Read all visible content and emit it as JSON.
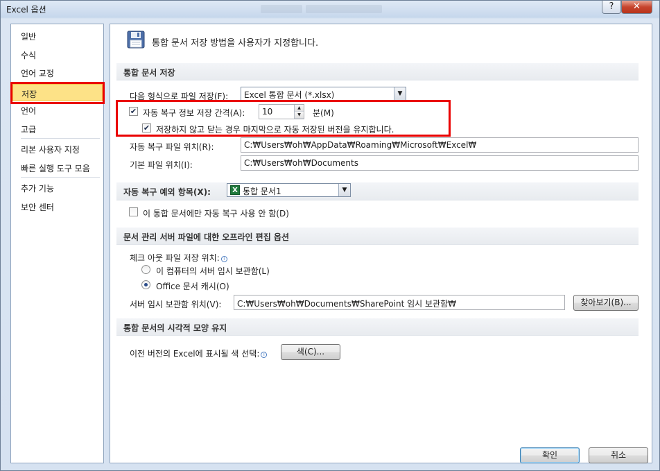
{
  "window": {
    "title": "Excel 옵션",
    "help_label": "?",
    "close_label": "✕"
  },
  "sidebar": {
    "items": [
      "일반",
      "수식",
      "언어 교정",
      "저장",
      "언어",
      "고급",
      "리본 사용자 지정",
      "빠른 실행 도구 모음",
      "추가 기능",
      "보안 센터"
    ],
    "selected": "저장"
  },
  "header": {
    "icon": "floppy-disk-icon",
    "text": "통합 문서 저장 방법을 사용자가 지정합니다."
  },
  "save_section": {
    "title": "통합 문서 저장",
    "format_label": "다음 형식으로 파일 저장(F):",
    "format_value": "Excel 통합 문서 (*.xlsx)",
    "autorecover_label": "자동 복구 정보 저장 간격(A):",
    "autorecover_checked": true,
    "autorecover_value": "10",
    "minutes_label": "분(M)",
    "keep_last_label": "저장하지 않고 닫는 경우 마지막으로 자동 저장된 버전을 유지합니다.",
    "keep_last_checked": true,
    "autorecover_location_label": "자동 복구 파일 위치(R):",
    "autorecover_location_value": "C:₩Users₩oh₩AppData₩Roaming₩Microsoft₩Excel₩",
    "default_location_label": "기본 파일 위치(I):",
    "default_location_value": "C:₩Users₩oh₩Documents"
  },
  "exception_section": {
    "title": "자동 복구 예외 항목(X):",
    "workbook_value": "통합 문서1",
    "disable_label": "이 통합 문서에만 자동 복구 사용 안 함(D)",
    "disable_checked": false
  },
  "offline_section": {
    "title": "문서 관리 서버 파일에 대한 오프라인 편집 옵션",
    "checkout_label": "체크 아웃 파일 저장 위치:",
    "radio_server": "이 컴퓨터의 서버 임시 보관함(L)",
    "radio_cache": "Office 문서 캐시(O)",
    "selected": "Office 문서 캐시(O)",
    "drafts_label": "서버 임시 보관함 위치(V):",
    "drafts_value": "C:₩Users₩oh₩Documents₩SharePoint 임시 보관함₩",
    "browse_label": "찾아보기(B)..."
  },
  "visual_section": {
    "title": "통합 문서의 시각적 모양 유지",
    "colors_label": "이전 버전의 Excel에 표시될 색 선택:",
    "colors_button": "색(C)..."
  },
  "footer": {
    "ok_label": "확인",
    "cancel_label": "취소"
  },
  "colors": {
    "highlight": "#ea0000",
    "selected_bg": "#fde287",
    "accent": "#3c7fb1"
  }
}
